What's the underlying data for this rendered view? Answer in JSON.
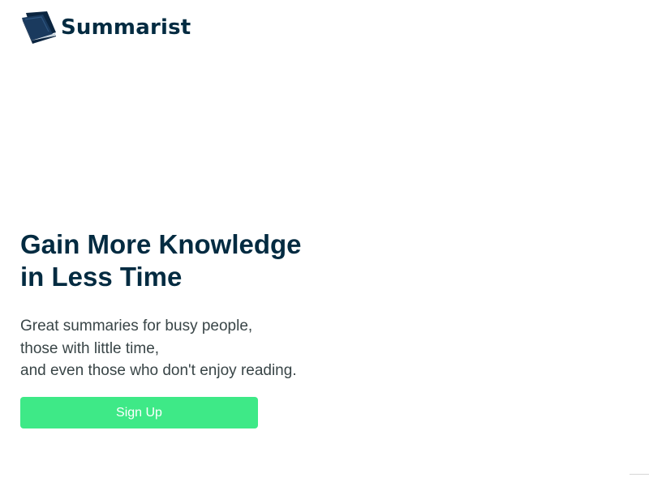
{
  "brand": {
    "name": "Summarist",
    "logo_icon": "book-icon"
  },
  "hero": {
    "title_lines": [
      "Gain More Knowledge",
      "in Less Time"
    ],
    "subtitle_lines": [
      "Great summaries for busy people,",
      "those with little time,",
      "and even those who don't enjoy reading."
    ],
    "cta_label": "Sign Up"
  },
  "colors": {
    "brand_navy": "#032b41",
    "cta_green": "#3ee987",
    "body_text": "#394547",
    "background": "#ffffff"
  }
}
